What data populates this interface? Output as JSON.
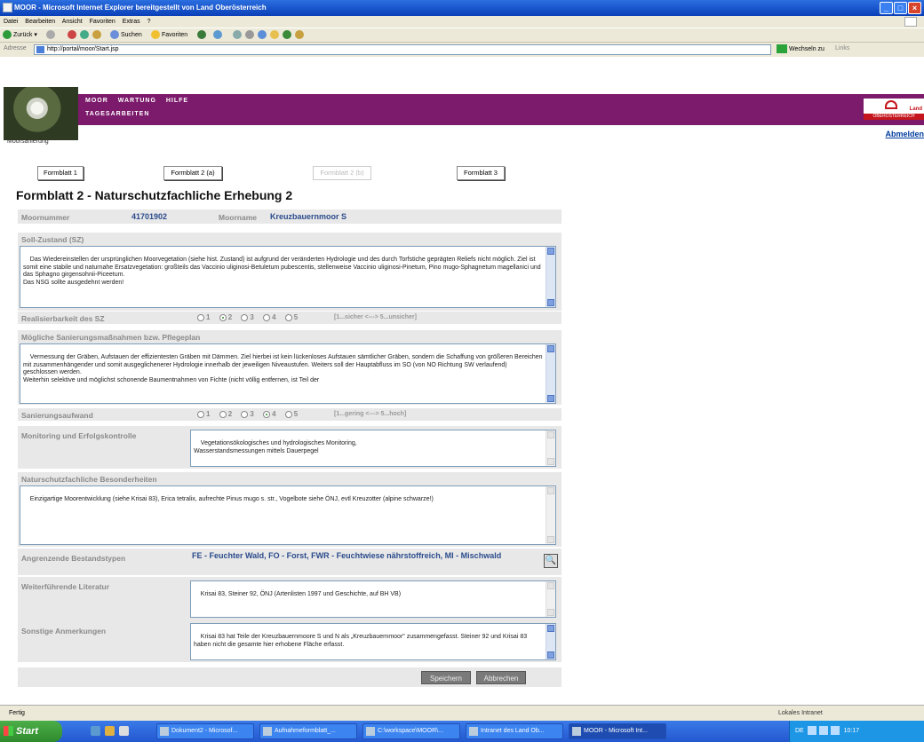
{
  "window": {
    "title": "MOOR - Microsoft Internet Explorer bereitgestellt von Land Oberösterreich"
  },
  "menu": [
    "Datei",
    "Bearbeiten",
    "Ansicht",
    "Favoriten",
    "Extras",
    "?"
  ],
  "toolbar": {
    "back": "Zurück",
    "search": "Suchen",
    "favorites": "Favoriten"
  },
  "address": {
    "label": "Adresse",
    "url": "http://portal/moor/Start.jsp",
    "go": "Wechseln zu",
    "links": "Links"
  },
  "header": {
    "nav": [
      "MOOR",
      "WARTUNG",
      "HILFE"
    ],
    "subnav": "TAGESARBEITEN",
    "logo_caption": "Moorsanierung",
    "org_name": "Land",
    "org_bar": "OBERÖSTERREICH",
    "logout": "Abmelden"
  },
  "tabs": [
    {
      "label": "Formblatt 1",
      "enabled": true
    },
    {
      "label": "Formblatt 2 (a)",
      "enabled": true
    },
    {
      "label": "Formblatt 2 (b)",
      "enabled": false
    },
    {
      "label": "Formblatt 3",
      "enabled": true
    }
  ],
  "form": {
    "title": "Formblatt 2 - Naturschutzfachliche Erhebung 2",
    "moor_number_label": "Moornummer",
    "moor_number": "41701902",
    "moor_name_label": "Moorname",
    "moor_name": "Kreuzbauernmoor S",
    "soll_label": "Soll-Zustand (SZ)",
    "soll_text": "Das Wiedereinstellen der ursprünglichen Moorvegetation (siehe hist. Zustand) ist aufgrund der veränderten Hydrologie und des durch Torfstiche geprägten Reliefs nicht möglich. Ziel ist somit eine stabile und naturnahe Ersatzvegetation: großteils das Vaccinio uliginosi-Betuletum pubescentis, stellenweise Vaccinio uliginosi-Pinetum, Pino mugo-Sphagnetum magellanici und das Sphagno girgensohnii-Piceetum.\nDas NSG sollte ausgedehnt werden!",
    "realisierbarkeit_label": "Realisierbarkeit des SZ",
    "realisierbarkeit_options": [
      "1",
      "2",
      "3",
      "4",
      "5"
    ],
    "realisierbarkeit_selected": 2,
    "realisierbarkeit_scale": "[1...sicher <---> 5...unsicher]",
    "massnahmen_label": "Mögliche Sanierungsmaßnahmen bzw. Pflegeplan",
    "massnahmen_text": "Vermessung der Gräben, Aufstauen der effizientesten Gräben mit Dämmen. Ziel hierbei ist kein lückenloses Aufstauen sämtlicher Gräben, sondern die Schaffung von größeren Bereichen mit zusammenhängender und somit ausgeglichenerer Hydrologie innerhalb der jeweiligen Niveaustufen. Weiters soll der Hauptabfluss im SO (von NO Richtung SW verlaufend) geschlossen werden.\nWeiterhin selektive und möglichst schonende Baumentnahmen von Fichte (nicht völlig entfernen, ist Teil der",
    "aufwand_label": "Sanierungsaufwand",
    "aufwand_options": [
      "1",
      "2",
      "3",
      "4",
      "5"
    ],
    "aufwand_selected": 4,
    "aufwand_scale": "[1...gering <---> 5...hoch]",
    "monitoring_label": "Monitoring und Erfolgskontrolle",
    "monitoring_text": "Vegetationsökologisches und hydrologisches Monitoring,\nWasserstandsmessungen mittels Dauerpegel",
    "besonderheiten_label": "Naturschutzfachliche Besonderheiten",
    "besonderheiten_text": "Einzigartige Moorentwicklung (siehe Krisai 83), Erica tetralix, aufrechte Pinus mugo s. str., Vogelbote siehe ÖNJ, evtl Kreuzotter (alpine schwarze!)",
    "bestandstypen_label": "Angrenzende Bestandstypen",
    "bestandstypen_value": "FE - Feuchter Wald, FO - Forst, FWR - Feuchtwiese nährstoffreich, MI - Mischwald",
    "literatur_label": "Weiterführende Literatur",
    "literatur_text": "Krisai 83, Steiner 92, ÖNJ (Artenlisten 1997 und Geschichte, auf BH VB)",
    "anmerkungen_label": "Sonstige Anmerkungen",
    "anmerkungen_text": "Krisai 83 hat Teile der Kreuzbauernmoore S und N als „Kreuzbauernmoor\" zusammengefasst. Steiner 92 und Krisai 83 haben nicht die gesamte hier erhobene Fläche erfasst.",
    "save": "Speichern",
    "cancel": "Abbrechen"
  },
  "status": {
    "text": "Fertig",
    "zone": "Lokales Intranet"
  },
  "taskbar": {
    "start": "Start",
    "tasks": [
      "Dokument2 - Microsof...",
      "Aufnahmeformblatt_...",
      "C:\\workspace\\MOOR\\...",
      "Intranet des Land Ob...",
      "MOOR - Microsoft Int..."
    ],
    "lang": "DE",
    "clock": "10:17"
  }
}
